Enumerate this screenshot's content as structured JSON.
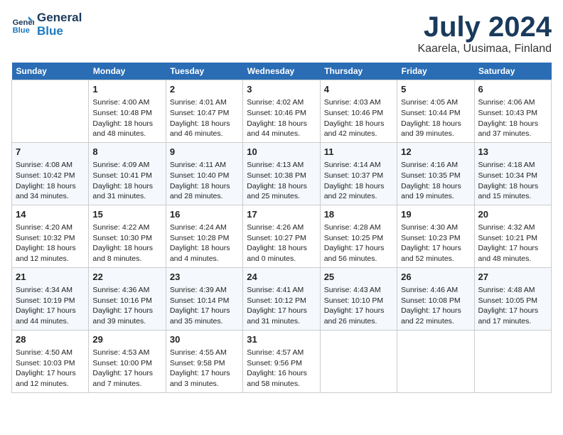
{
  "logo": {
    "line1": "General",
    "line2": "Blue"
  },
  "title": "July 2024",
  "location": "Kaarela, Uusimaa, Finland",
  "weekdays": [
    "Sunday",
    "Monday",
    "Tuesday",
    "Wednesday",
    "Thursday",
    "Friday",
    "Saturday"
  ],
  "weeks": [
    [
      {
        "day": "",
        "info": ""
      },
      {
        "day": "1",
        "info": "Sunrise: 4:00 AM\nSunset: 10:48 PM\nDaylight: 18 hours\nand 48 minutes."
      },
      {
        "day": "2",
        "info": "Sunrise: 4:01 AM\nSunset: 10:47 PM\nDaylight: 18 hours\nand 46 minutes."
      },
      {
        "day": "3",
        "info": "Sunrise: 4:02 AM\nSunset: 10:46 PM\nDaylight: 18 hours\nand 44 minutes."
      },
      {
        "day": "4",
        "info": "Sunrise: 4:03 AM\nSunset: 10:46 PM\nDaylight: 18 hours\nand 42 minutes."
      },
      {
        "day": "5",
        "info": "Sunrise: 4:05 AM\nSunset: 10:44 PM\nDaylight: 18 hours\nand 39 minutes."
      },
      {
        "day": "6",
        "info": "Sunrise: 4:06 AM\nSunset: 10:43 PM\nDaylight: 18 hours\nand 37 minutes."
      }
    ],
    [
      {
        "day": "7",
        "info": "Sunrise: 4:08 AM\nSunset: 10:42 PM\nDaylight: 18 hours\nand 34 minutes."
      },
      {
        "day": "8",
        "info": "Sunrise: 4:09 AM\nSunset: 10:41 PM\nDaylight: 18 hours\nand 31 minutes."
      },
      {
        "day": "9",
        "info": "Sunrise: 4:11 AM\nSunset: 10:40 PM\nDaylight: 18 hours\nand 28 minutes."
      },
      {
        "day": "10",
        "info": "Sunrise: 4:13 AM\nSunset: 10:38 PM\nDaylight: 18 hours\nand 25 minutes."
      },
      {
        "day": "11",
        "info": "Sunrise: 4:14 AM\nSunset: 10:37 PM\nDaylight: 18 hours\nand 22 minutes."
      },
      {
        "day": "12",
        "info": "Sunrise: 4:16 AM\nSunset: 10:35 PM\nDaylight: 18 hours\nand 19 minutes."
      },
      {
        "day": "13",
        "info": "Sunrise: 4:18 AM\nSunset: 10:34 PM\nDaylight: 18 hours\nand 15 minutes."
      }
    ],
    [
      {
        "day": "14",
        "info": "Sunrise: 4:20 AM\nSunset: 10:32 PM\nDaylight: 18 hours\nand 12 minutes."
      },
      {
        "day": "15",
        "info": "Sunrise: 4:22 AM\nSunset: 10:30 PM\nDaylight: 18 hours\nand 8 minutes."
      },
      {
        "day": "16",
        "info": "Sunrise: 4:24 AM\nSunset: 10:28 PM\nDaylight: 18 hours\nand 4 minutes."
      },
      {
        "day": "17",
        "info": "Sunrise: 4:26 AM\nSunset: 10:27 PM\nDaylight: 18 hours\nand 0 minutes."
      },
      {
        "day": "18",
        "info": "Sunrise: 4:28 AM\nSunset: 10:25 PM\nDaylight: 17 hours\nand 56 minutes."
      },
      {
        "day": "19",
        "info": "Sunrise: 4:30 AM\nSunset: 10:23 PM\nDaylight: 17 hours\nand 52 minutes."
      },
      {
        "day": "20",
        "info": "Sunrise: 4:32 AM\nSunset: 10:21 PM\nDaylight: 17 hours\nand 48 minutes."
      }
    ],
    [
      {
        "day": "21",
        "info": "Sunrise: 4:34 AM\nSunset: 10:19 PM\nDaylight: 17 hours\nand 44 minutes."
      },
      {
        "day": "22",
        "info": "Sunrise: 4:36 AM\nSunset: 10:16 PM\nDaylight: 17 hours\nand 39 minutes."
      },
      {
        "day": "23",
        "info": "Sunrise: 4:39 AM\nSunset: 10:14 PM\nDaylight: 17 hours\nand 35 minutes."
      },
      {
        "day": "24",
        "info": "Sunrise: 4:41 AM\nSunset: 10:12 PM\nDaylight: 17 hours\nand 31 minutes."
      },
      {
        "day": "25",
        "info": "Sunrise: 4:43 AM\nSunset: 10:10 PM\nDaylight: 17 hours\nand 26 minutes."
      },
      {
        "day": "26",
        "info": "Sunrise: 4:46 AM\nSunset: 10:08 PM\nDaylight: 17 hours\nand 22 minutes."
      },
      {
        "day": "27",
        "info": "Sunrise: 4:48 AM\nSunset: 10:05 PM\nDaylight: 17 hours\nand 17 minutes."
      }
    ],
    [
      {
        "day": "28",
        "info": "Sunrise: 4:50 AM\nSunset: 10:03 PM\nDaylight: 17 hours\nand 12 minutes."
      },
      {
        "day": "29",
        "info": "Sunrise: 4:53 AM\nSunset: 10:00 PM\nDaylight: 17 hours\nand 7 minutes."
      },
      {
        "day": "30",
        "info": "Sunrise: 4:55 AM\nSunset: 9:58 PM\nDaylight: 17 hours\nand 3 minutes."
      },
      {
        "day": "31",
        "info": "Sunrise: 4:57 AM\nSunset: 9:56 PM\nDaylight: 16 hours\nand 58 minutes."
      },
      {
        "day": "",
        "info": ""
      },
      {
        "day": "",
        "info": ""
      },
      {
        "day": "",
        "info": ""
      }
    ]
  ]
}
